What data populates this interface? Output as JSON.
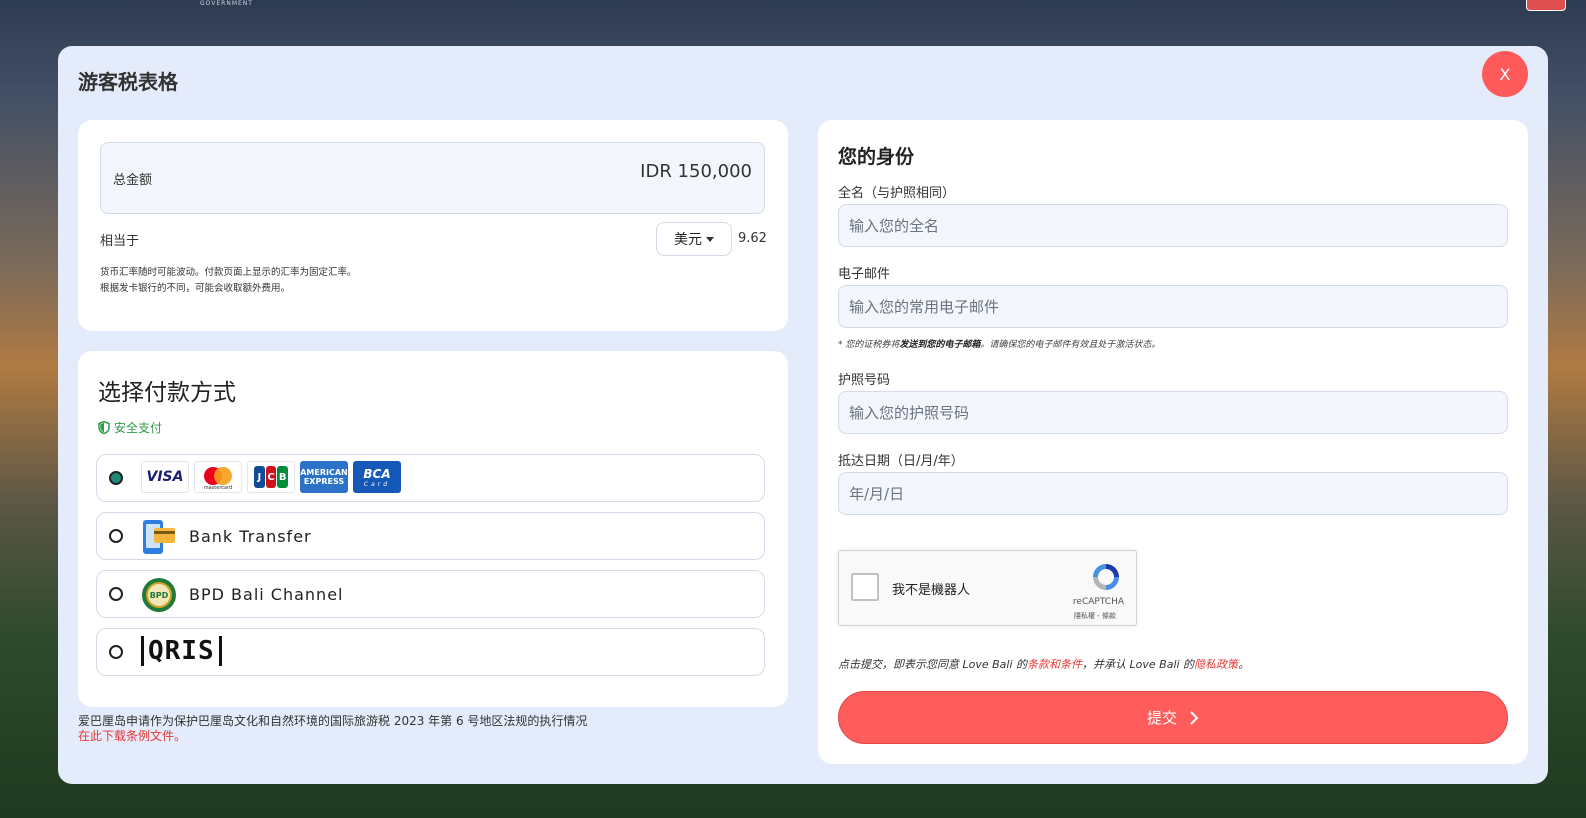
{
  "modal": {
    "title": "游客税表格",
    "close_label": "X"
  },
  "total": {
    "label": "总金额",
    "value": "IDR 150,000",
    "equivalent_label": "相当于",
    "currency": "美元",
    "equivalent_value": "9.62",
    "note_line1": "货币汇率随时可能波动。付款页面上显示的汇率为固定汇率。",
    "note_line2": "根据发卡银行的不同，可能会收取额外费用。"
  },
  "payment": {
    "title": "选择付款方式",
    "secure_label": "安全支付",
    "methods": [
      {
        "label": "",
        "selected": true
      },
      {
        "label": "Bank Transfer",
        "selected": false
      },
      {
        "label": "BPD Bali Channel",
        "selected": false
      },
      {
        "label": "QRIS",
        "selected": false
      }
    ],
    "card_logos": {
      "visa": "VISA",
      "mastercard": "mastercard",
      "jcb": [
        "J",
        "C",
        "B"
      ],
      "amex_line1": "AMERICAN",
      "amex_line2": "EXPRESS",
      "bca": "BCA",
      "bca_sub": "Card"
    },
    "bpd_badge": "BPD"
  },
  "footer": {
    "law_text": "爱巴厘岛申请作为保护巴厘岛文化和自然环境的国际旅游税 2023 年第 6 号地区法规的执行情况",
    "download_link": "在此下载条例文件。"
  },
  "identity": {
    "title": "您的身份",
    "full_name": {
      "label": "全名（与护照相同）",
      "placeholder": "输入您的全名",
      "value": ""
    },
    "email": {
      "label": "电子邮件",
      "placeholder": "输入您的常用电子邮件",
      "value": ""
    },
    "email_note_pre": "* 您的证税券将",
    "email_note_bold": "发送到您的电子邮箱",
    "email_note_post": "。请确保您的电子邮件有效且处于激活状态。",
    "passport": {
      "label": "护照号码",
      "placeholder": "输入您的护照号码",
      "value": ""
    },
    "arrival": {
      "label": "抵达日期（日/月/年）",
      "placeholder": "年/月/日",
      "value": ""
    },
    "captcha": {
      "text": "我不是機器人",
      "brand": "reCAPTCHA",
      "links": "隱私權 - 條款"
    },
    "agree": {
      "pre": "点击提交，即表示您同意 Love Bali 的",
      "terms": "条款和条件",
      "mid": "，并承认 Love Bali 的",
      "privacy": "隐私政策",
      "post": "。"
    },
    "submit_label": "提交"
  },
  "background": {
    "logo_text": "GOVERNMENT"
  },
  "colors": {
    "accent": "#ff5c5c",
    "modal_bg": "#e4ebfb",
    "secure_green": "#2e9c4a",
    "link_red": "#e53935"
  }
}
